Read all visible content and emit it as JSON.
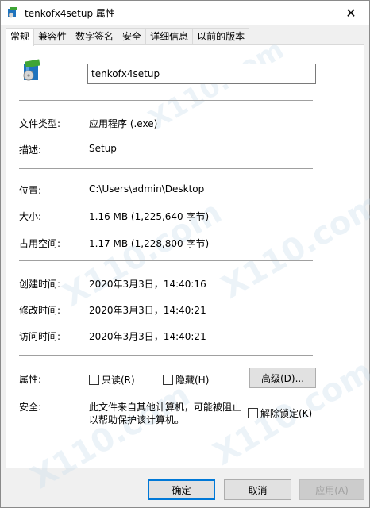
{
  "window": {
    "title": "tenkofx4setup 属性",
    "close_glyph": "✕"
  },
  "tabs": [
    {
      "label": "常规",
      "active": true
    },
    {
      "label": "兼容性",
      "active": false
    },
    {
      "label": "数字签名",
      "active": false
    },
    {
      "label": "安全",
      "active": false
    },
    {
      "label": "详细信息",
      "active": false
    },
    {
      "label": "以前的版本",
      "active": false
    }
  ],
  "general": {
    "file_name": "tenkofx4setup",
    "file_type_label": "文件类型:",
    "file_type_value": "应用程序 (.exe)",
    "description_label": "描述:",
    "description_value": "Setup",
    "location_label": "位置:",
    "location_value": "C:\\Users\\admin\\Desktop",
    "size_label": "大小:",
    "size_value": "1.16 MB (1,225,640 字节)",
    "size_on_disk_label": "占用空间:",
    "size_on_disk_value": "1.17 MB (1,228,800 字节)",
    "created_label": "创建时间:",
    "created_value": "2020年3月3日，14:40:16",
    "modified_label": "修改时间:",
    "modified_value": "2020年3月3日，14:40:21",
    "accessed_label": "访问时间:",
    "accessed_value": "2020年3月3日，14:40:21",
    "attributes_label": "属性:",
    "readonly_label": "只读(R)",
    "hidden_label": "隐藏(H)",
    "advanced_button": "高级(D)...",
    "security_label": "安全:",
    "security_text": "此文件来自其他计算机，可能被阻止以帮助保护该计算机。",
    "unblock_label": "解除锁定(K)"
  },
  "footer": {
    "ok": "确定",
    "cancel": "取消",
    "apply": "应用(A)"
  },
  "watermark_text": "X110.com",
  "colors": {
    "accent": "#0078d7",
    "panel_bg": "#ffffff",
    "window_bg": "#f0f0f0"
  }
}
